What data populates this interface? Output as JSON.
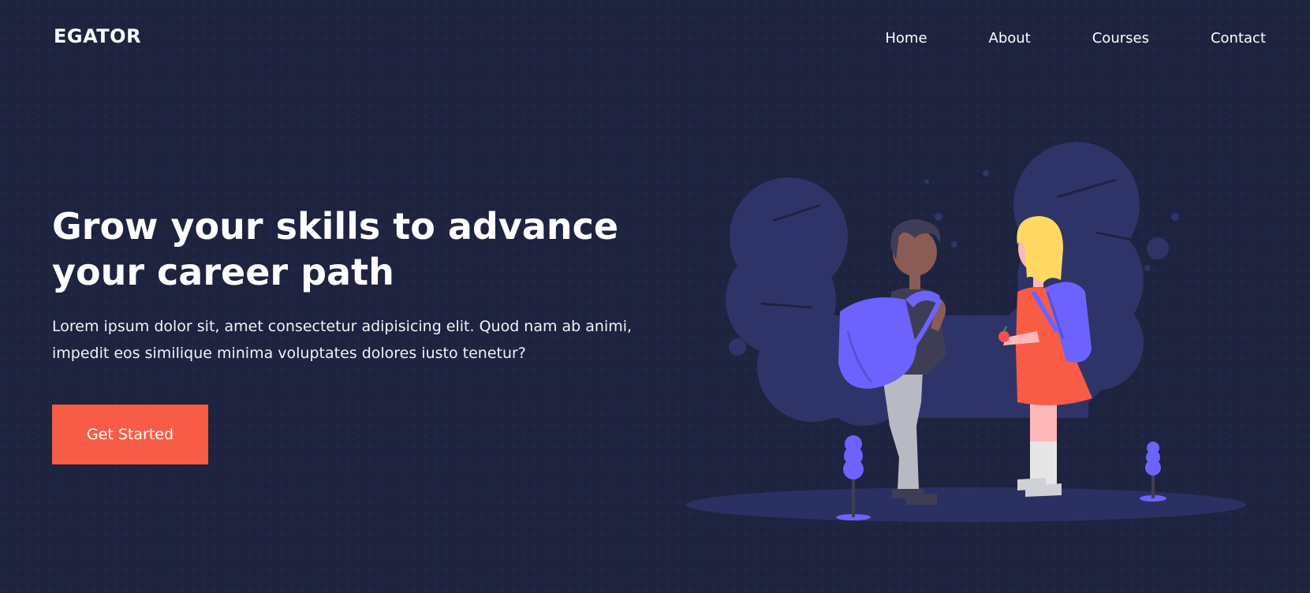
{
  "header": {
    "brand": "EGATOR",
    "nav": [
      {
        "label": "Home"
      },
      {
        "label": "About"
      },
      {
        "label": "Courses"
      },
      {
        "label": "Contact"
      }
    ]
  },
  "hero": {
    "title": "Grow your skills to advance your career path",
    "description": "Lorem ipsum dolor sit, amet consectetur adipisicing elit. Quod nam ab animi, impedit eos similique minima voluptates dolores iusto tenetur?",
    "cta_label": "Get Started"
  },
  "colors": {
    "background": "#1e2340",
    "accent": "#f85c45",
    "illustration_primary": "#6c63ff",
    "foliage": "#2f3468"
  },
  "icons": {
    "illustration": "students-with-backpacks-illustration"
  }
}
